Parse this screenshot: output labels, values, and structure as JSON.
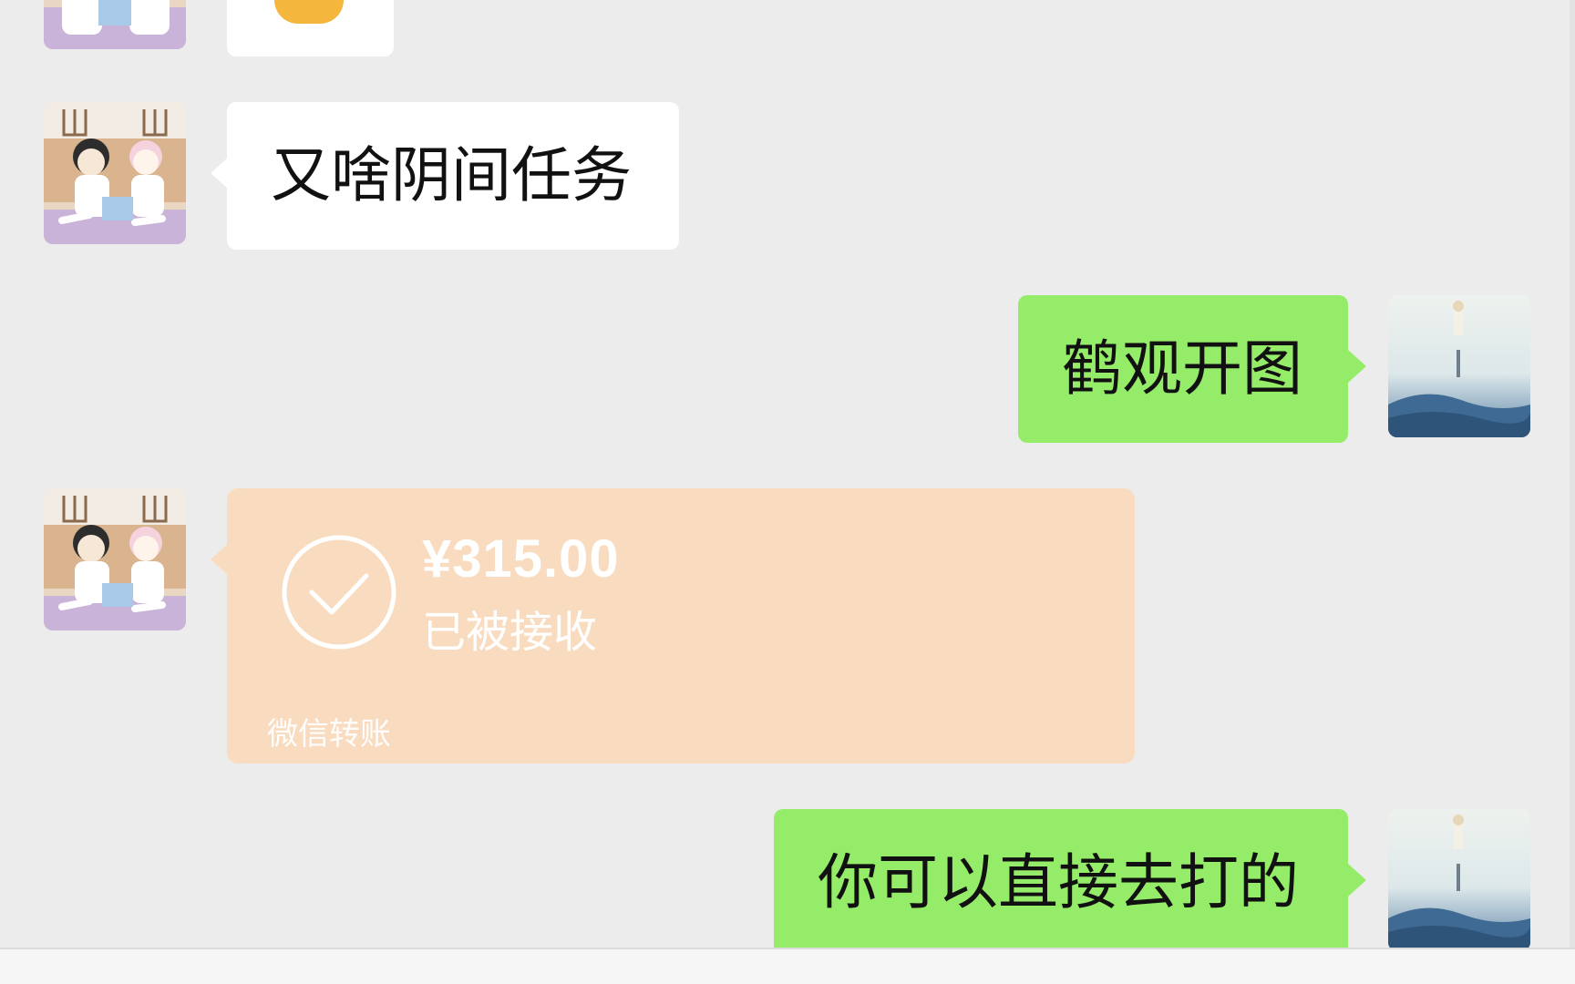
{
  "messages": {
    "m1_text": "又啥阴间任务",
    "m2_text": "鹤观开图",
    "m3_transfer": {
      "amount": "¥315.00",
      "status": "已被接收",
      "brand": "微信转账"
    },
    "m4_text": "你可以直接去打的"
  },
  "colors": {
    "background": "#ececec",
    "incoming_bubble": "#ffffff",
    "outgoing_bubble": "#95ec69",
    "transfer_card": "#f9dcbf"
  },
  "icons": {
    "check": "check-circle-icon",
    "sticker": "emoji-sticker-icon"
  }
}
